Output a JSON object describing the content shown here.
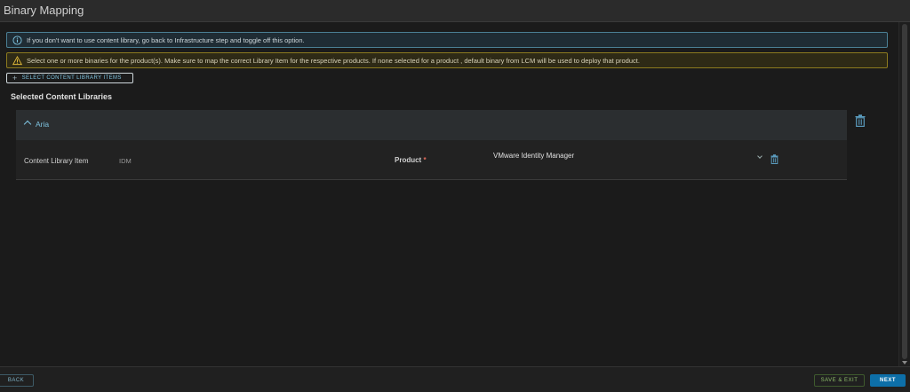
{
  "window": {
    "title": "Binary Mapping"
  },
  "alerts": {
    "info": "If you don't want to use content library, go back to Infrastructure step and toggle off this option.",
    "warning": "Select one or more binaries for the product(s). Make sure to map the correct Library Item for the respective products. If none selected for a product , default binary from LCM will be used to deploy that product."
  },
  "toolbar": {
    "select_items_label": "SELECT CONTENT LIBRARY ITEMS"
  },
  "section": {
    "title": "Selected Content Libraries"
  },
  "library": {
    "name": "Aria",
    "item_label": "Content Library Item",
    "item_value": "IDM",
    "product_label": "Product",
    "required_mark": "*",
    "product_value": "VMware Identity Manager"
  },
  "footer": {
    "back_label": "BACK",
    "save_exit_label": "SAVE & EXIT",
    "next_label": "NEXT"
  },
  "colors": {
    "accent": "#7fc4e0",
    "primary_button": "#0d6fa8",
    "info_border": "#4b7f94",
    "warning_border": "#8c7a1f",
    "save_text": "#8fbf6a"
  },
  "icons": {
    "info": "info-circle-icon",
    "warning": "warning-triangle-icon",
    "add": "plus-icon",
    "collapse": "chevron-up-icon",
    "dropdown": "chevron-down-icon",
    "delete": "trash-icon"
  }
}
